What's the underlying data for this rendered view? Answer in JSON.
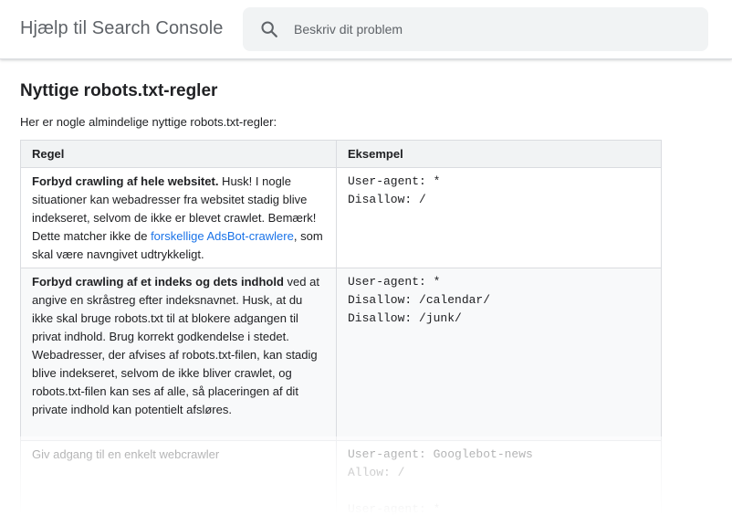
{
  "header": {
    "title": "Hjælp til Search Console",
    "search_placeholder": "Beskriv dit problem"
  },
  "main": {
    "title": "Nyttige robots.txt-regler",
    "intro": "Her er nogle almindelige nyttige robots.txt-regler:",
    "table": {
      "headers": [
        "Regel",
        "Eksempel"
      ],
      "rows": [
        {
          "rule_bold": "Forbyd crawling af hele websitet.",
          "rule_text": " Husk! I nogle situationer kan webadresser fra websitet stadig blive indekseret, selvom de ikke er blevet crawlet. Bemærk! Dette matcher ikke de ",
          "rule_link": "forskellige AdsBot-crawlere",
          "rule_after": ", som skal være navngivet udtrykkeligt.",
          "example": "User-agent: *\nDisallow: /"
        },
        {
          "rule_bold": "Forbyd crawling af et indeks og dets indhold",
          "rule_text": " ved at angive en skråstreg efter indeksnavnet. Husk, at du ikke skal bruge robots.txt til at blokere adgangen til privat indhold. Brug korrekt godkendelse i stedet. Webadresser, der afvises af robots.txt-filen, kan stadig blive indekseret, selvom de ikke bliver crawlet, og robots.txt-filen kan ses af alle, så placeringen af dit private indhold kan potentielt afsløres.",
          "example": "User-agent: *\nDisallow: /calendar/\nDisallow: /junk/"
        },
        {
          "rule_text": "Giv adgang til en enkelt webcrawler",
          "example": "User-agent: Googlebot-news\nAllow: /\n\nUser-agent: *"
        }
      ]
    }
  },
  "icons": {
    "search": "search-icon"
  },
  "colors": {
    "link": "#1a73e8",
    "header_text": "#5f6368",
    "search_bg": "#f1f3f4",
    "table_header_bg": "#f1f3f4",
    "border": "#dadce0"
  }
}
